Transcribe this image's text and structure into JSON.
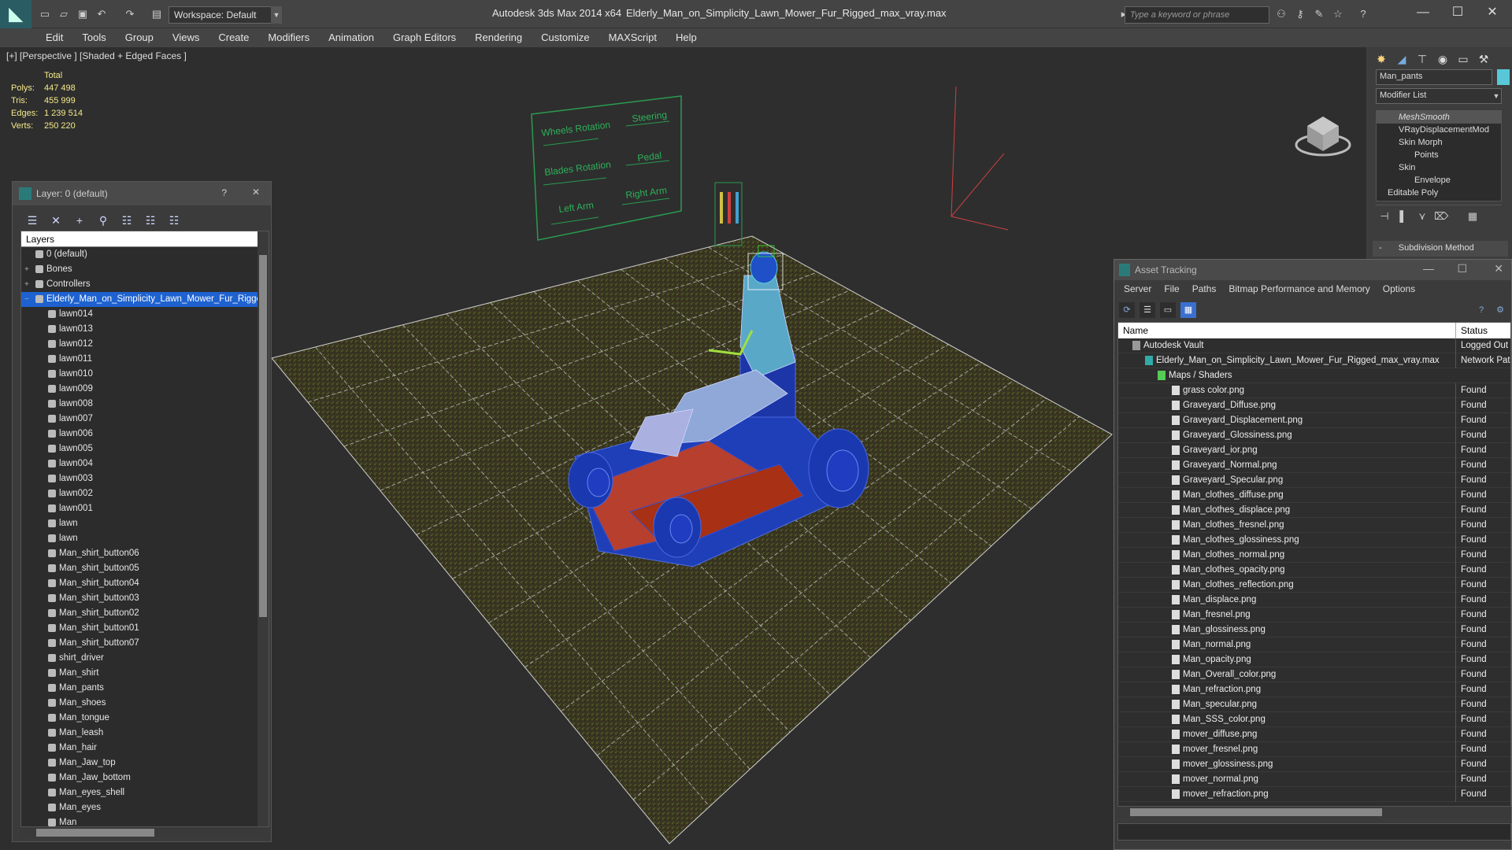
{
  "titlebar": {
    "workspace": "Workspace: Default",
    "app_title": "Autodesk 3ds Max  2014 x64",
    "file_title": "Elderly_Man_on_Simplicity_Lawn_Mower_Fur_Rigged_max_vray.max",
    "search_placeholder": "Type a keyword or phrase"
  },
  "menu": [
    "Edit",
    "Tools",
    "Group",
    "Views",
    "Create",
    "Modifiers",
    "Animation",
    "Graph Editors",
    "Rendering",
    "Customize",
    "MAXScript",
    "Help"
  ],
  "viewport": {
    "label": "[+] [Perspective ] [Shaded + Edged Faces ]",
    "stats_header": "Total",
    "stats": [
      {
        "label": "Polys:",
        "value": "447 498"
      },
      {
        "label": "Tris:",
        "value": "455 999"
      },
      {
        "label": "Edges:",
        "value": "1 239 514"
      },
      {
        "label": "Verts:",
        "value": "250 220"
      }
    ],
    "control_labels": [
      "Wheels Rotation",
      "Steering",
      "Blades Rotation",
      "Pedal",
      "Left Arm",
      "Right Arm"
    ]
  },
  "layer_dialog": {
    "title": "Layer: 0 (default)",
    "help": "?",
    "close": "✕",
    "header": "Layers",
    "top_layers": [
      "0 (default)",
      "Bones",
      "Controllers"
    ],
    "selected_layer": "Elderly_Man_on_Simplicity_Lawn_Mower_Fur_Rigged",
    "children": [
      "lawn014",
      "lawn013",
      "lawn012",
      "lawn011",
      "lawn010",
      "lawn009",
      "lawn008",
      "lawn007",
      "lawn006",
      "lawn005",
      "lawn004",
      "lawn003",
      "lawn002",
      "lawn001",
      "lawn",
      "lawn",
      "Man_shirt_button06",
      "Man_shirt_button05",
      "Man_shirt_button04",
      "Man_shirt_button03",
      "Man_shirt_button02",
      "Man_shirt_button01",
      "Man_shirt_button07",
      "shirt_driver",
      "Man_shirt",
      "Man_pants",
      "Man_shoes",
      "Man_tongue",
      "Man_leash",
      "Man_hair",
      "Man_Jaw_top",
      "Man_Jaw_bottom",
      "Man_eyes_shell",
      "Man_eyes",
      "Man"
    ]
  },
  "command_panel": {
    "object_name": "Man_pants",
    "object_color": "#58c8d8",
    "modifier_list": "Modifier List",
    "stack": [
      "MeshSmooth",
      "VRayDisplacementMod",
      "Skin Morph",
      "Points",
      "Skin",
      "Envelope",
      "Editable Poly"
    ],
    "rollout": "Subdivision Method"
  },
  "asset_tracking": {
    "title": "Asset Tracking",
    "menu": [
      "Server",
      "File",
      "Paths",
      "Bitmap Performance and Memory",
      "Options"
    ],
    "col_name": "Name",
    "col_status": "Status",
    "vault": {
      "name": "Autodesk Vault",
      "status": "Logged Out"
    },
    "file": {
      "name": "Elderly_Man_on_Simplicity_Lawn_Mower_Fur_Rigged_max_vray.max",
      "status": "Network Path"
    },
    "group": "Maps / Shaders",
    "maps": [
      "grass color.png",
      "Graveyard_Diffuse.png",
      "Graveyard_Displacement.png",
      "Graveyard_Glossiness.png",
      "Graveyard_ior.png",
      "Graveyard_Normal.png",
      "Graveyard_Specular.png",
      "Man_clothes_diffuse.png",
      "Man_clothes_displace.png",
      "Man_clothes_fresnel.png",
      "Man_clothes_glossiness.png",
      "Man_clothes_normal.png",
      "Man_clothes_opacity.png",
      "Man_clothes_reflection.png",
      "Man_displace.png",
      "Man_fresnel.png",
      "Man_glossiness.png",
      "Man_normal.png",
      "Man_opacity.png",
      "Man_Overall_color.png",
      "Man_refraction.png",
      "Man_specular.png",
      "Man_SSS_color.png",
      "mover_diffuse.png",
      "mover_fresnel.png",
      "mover_glossiness.png",
      "mover_normal.png",
      "mover_refraction.png"
    ],
    "map_status": "Found"
  },
  "colors": {
    "selection": "#1e62d0",
    "stats": "#f4e98a",
    "grid": "#c8c8c8",
    "mower_red": "#d04020",
    "mower_blue": "#2040c0",
    "rig_green": "#30c060"
  }
}
